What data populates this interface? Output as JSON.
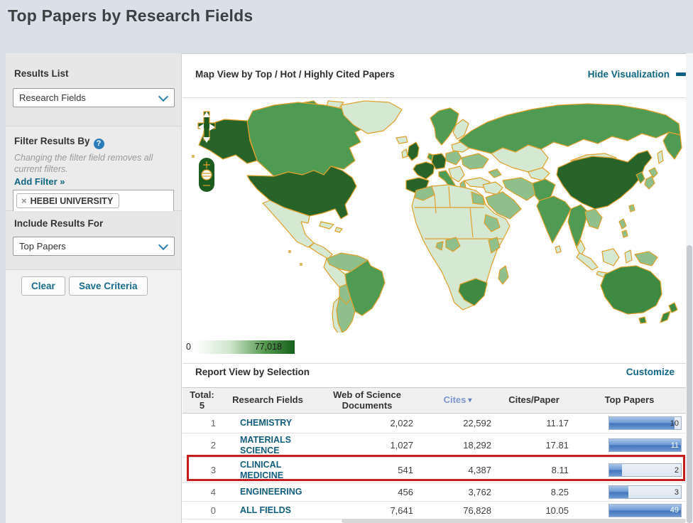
{
  "page": {
    "title": "Top Papers by Research Fields"
  },
  "sidebar": {
    "results_list": {
      "label": "Results List",
      "dropdown_value": "Research Fields"
    },
    "filter": {
      "label": "Filter Results By",
      "help_icon": "question-mark-icon",
      "note": "Changing the filter field removes all current filters.",
      "add_filter_label": "Add Filter »",
      "tag": {
        "remove_icon": "×",
        "label": "HEBEI UNIVERSITY"
      }
    },
    "include_results": {
      "label": "Include Results For",
      "dropdown_value": "Top Papers"
    },
    "buttons": {
      "clear": "Clear",
      "save": "Save Criteria"
    }
  },
  "map_panel": {
    "title": "Map View by Top / Hot / Highly Cited Papers",
    "hide_link": "Hide Visualization",
    "scale": {
      "min": "0",
      "max": "77,018"
    },
    "controls": {
      "zoom_in": "+",
      "zoom_out": "−",
      "globe": "globe-icon",
      "pan": "pan-arrows-icon"
    },
    "shading_note": {
      "darkest": [
        "USA",
        "China",
        "France",
        "Germany",
        "Spain",
        "UK"
      ],
      "medium": [
        "Canada",
        "Russia",
        "Brazil",
        "India",
        "Australia",
        "South Africa",
        "New Zealand",
        "Scandinavia"
      ],
      "pale": [
        "Greenland",
        "Mexico",
        "Central Asia",
        "most of Africa"
      ]
    }
  },
  "report": {
    "title": "Report View by Selection",
    "customize_link": "Customize",
    "table": {
      "total_label": "Total:",
      "total_value": "5",
      "headers": {
        "field": "Research Fields",
        "wos": "Web of Science Documents",
        "cites": "Cites",
        "cpp": "Cites/Paper",
        "top_papers": "Top Papers"
      },
      "sort_column": "Cites",
      "rows": [
        {
          "rank": "1",
          "field": "CHEMISTRY",
          "wos_documents": "2,022",
          "cites": "22,592",
          "cites_per_paper": "11.17",
          "top_papers": "10",
          "bar_percent": 91,
          "highlighted": false
        },
        {
          "rank": "2",
          "field": "MATERIALS SCIENCE",
          "wos_documents": "1,027",
          "cites": "18,292",
          "cites_per_paper": "17.81",
          "top_papers": "11",
          "bar_percent": 100,
          "highlighted": false
        },
        {
          "rank": "3",
          "field": "CLINICAL MEDICINE",
          "wos_documents": "541",
          "cites": "4,387",
          "cites_per_paper": "8.11",
          "top_papers": "2",
          "bar_percent": 18,
          "highlighted": true
        },
        {
          "rank": "4",
          "field": "ENGINEERING",
          "wos_documents": "456",
          "cites": "3,762",
          "cites_per_paper": "8.25",
          "top_papers": "3",
          "bar_percent": 27,
          "highlighted": false
        },
        {
          "rank": "0",
          "field": "ALL FIELDS",
          "wos_documents": "7,641",
          "cites": "76,828",
          "cites_per_paper": "10.05",
          "top_papers": "49",
          "bar_percent": 100,
          "highlighted": false
        }
      ]
    }
  },
  "colors": {
    "accent_teal": "#106685",
    "cites_link_blue": "#7b97ce",
    "field_link": "#135e7e",
    "map_dark_green": "#28642a",
    "map_medium_green": "#4f9b54",
    "map_pale_green": "#d5e8d2",
    "map_border_orange": "#dfa02b",
    "bar_blue": "#4374bc",
    "highlight_red": "#c41e1e"
  }
}
